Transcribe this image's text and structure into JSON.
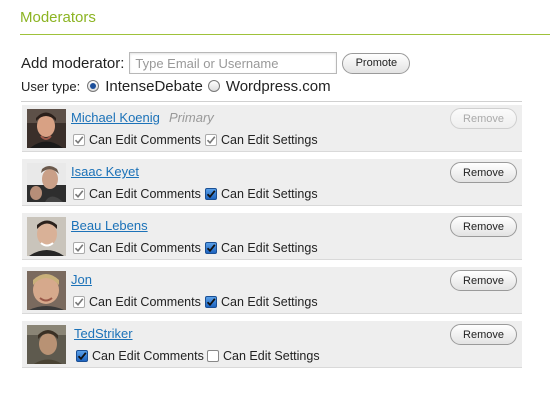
{
  "section": {
    "title": "Moderators"
  },
  "add_moderator": {
    "label": "Add moderator:",
    "input_value": "",
    "input_placeholder": "Type Email or Username",
    "promote_label": "Promote"
  },
  "user_type": {
    "label": "User type:",
    "options": [
      {
        "label": "IntenseDebate",
        "selected": true
      },
      {
        "label": "Wordpress.com",
        "selected": false
      }
    ]
  },
  "moderators": [
    {
      "name": "Michael Koenig",
      "role": "Primary",
      "perm1": "Can Edit Comments",
      "perm1_checked": true,
      "perm2": "Can Edit Settings",
      "perm2_checked": true,
      "remove": "Remove",
      "remove_disabled": true
    },
    {
      "name": "Isaac Keyet",
      "role": "",
      "perm1": "Can Edit Comments",
      "perm1_checked": true,
      "perm2": "Can Edit Settings",
      "perm2_checked": true,
      "remove": "Remove",
      "remove_disabled": false
    },
    {
      "name": "Beau Lebens",
      "role": "",
      "perm1": "Can Edit Comments",
      "perm1_checked": true,
      "perm2": "Can Edit Settings",
      "perm2_checked": true,
      "remove": "Remove",
      "remove_disabled": false
    },
    {
      "name": "Jon",
      "role": "",
      "perm1": "Can Edit Comments",
      "perm1_checked": true,
      "perm2": "Can Edit Settings",
      "perm2_checked": true,
      "remove": "Remove",
      "remove_disabled": false
    },
    {
      "name": "TedStriker",
      "role": "",
      "perm1": "Can Edit Comments",
      "perm1_checked": true,
      "perm2": "Can Edit Settings",
      "perm2_checked": false,
      "remove": "Remove",
      "remove_disabled": false
    }
  ],
  "colors": {
    "accent_green": "#8cb423",
    "link_blue": "#1c72b8",
    "row_bg": "#eeeeee"
  }
}
